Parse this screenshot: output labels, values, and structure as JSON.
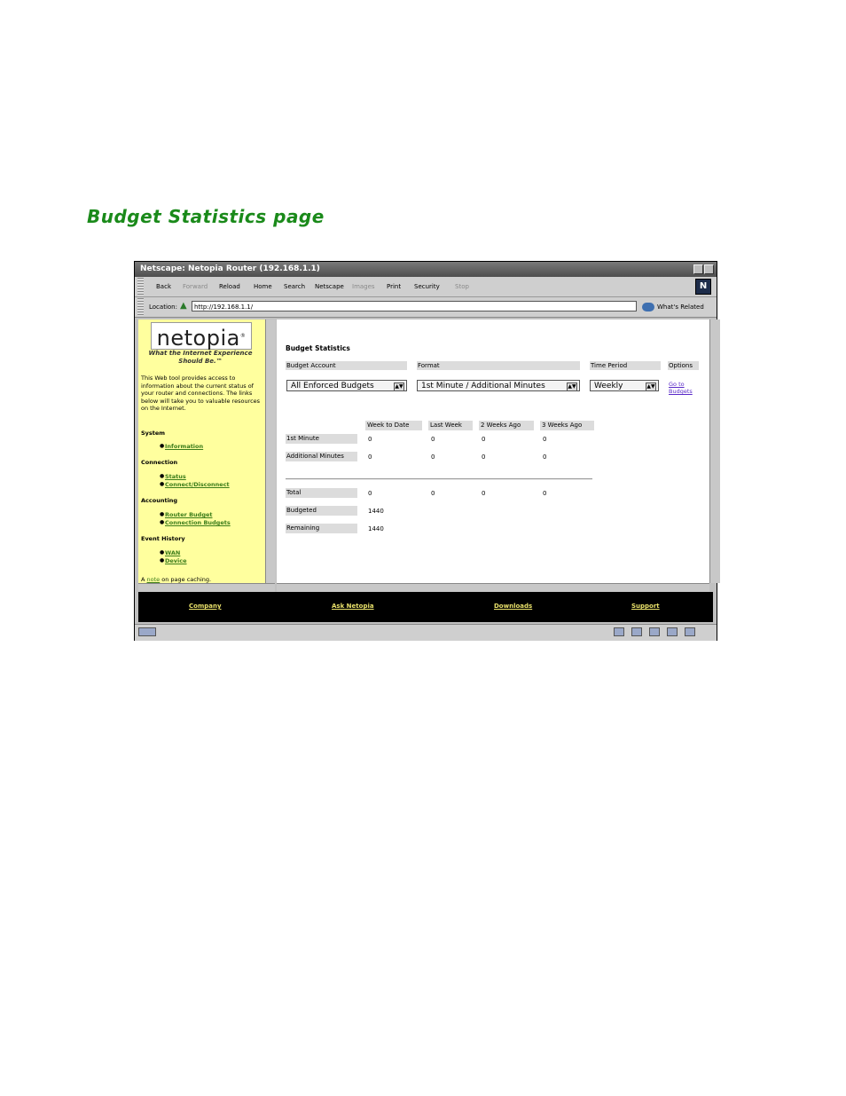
{
  "doc": {
    "heading": "Budget Statistics page"
  },
  "window": {
    "title": "Netscape: Netopia Router (192.168.1.1)"
  },
  "toolbar": {
    "items": [
      "Back",
      "Forward",
      "Reload",
      "Home",
      "Search",
      "Netscape",
      "Images",
      "Print",
      "Security",
      "Stop"
    ],
    "disabled": [
      "Forward",
      "Images",
      "Stop"
    ],
    "logo": "N"
  },
  "location": {
    "label": "Location:",
    "url": "http://192.168.1.1/",
    "related": "What's Related"
  },
  "sidebar": {
    "logo": "netopia",
    "logo_mark": "®",
    "tagline": "What the Internet Experience Should Be.™",
    "intro": "This Web tool provides access to information about the current status of your router and connections. The links below will take you to valuable resources on the Internet.",
    "sections": [
      {
        "title": "System",
        "links": [
          "Information"
        ]
      },
      {
        "title": "Connection",
        "links": [
          "Status",
          "Connect/Disconnect"
        ]
      },
      {
        "title": "Accounting",
        "links": [
          "Router Budget",
          "Connection Budgets"
        ]
      },
      {
        "title": "Event History",
        "links": [
          "WAN",
          "Device"
        ]
      }
    ],
    "note_prefix": "A",
    "note_link": "note",
    "note_suffix": "on page caching."
  },
  "main": {
    "heading": "Budget Statistics",
    "filters": {
      "account_label": "Budget Account",
      "format_label": "Format",
      "period_label": "Time Period",
      "options_label": "Options",
      "account_value": "All Enforced Budgets",
      "format_value": "1st Minute / Additional Minutes",
      "period_value": "Weekly",
      "goto_link": "Go to Budgets"
    },
    "columns": [
      "Week to Date",
      "Last Week",
      "2 Weeks Ago",
      "3 Weeks Ago"
    ],
    "rows": [
      {
        "label": "1st Minute",
        "values": [
          "0",
          "0",
          "0",
          "0"
        ]
      },
      {
        "label": "Additional Minutes",
        "values": [
          "0",
          "0",
          "0",
          "0"
        ]
      }
    ],
    "totals": [
      {
        "label": "Total",
        "values": [
          "0",
          "0",
          "0",
          "0"
        ]
      },
      {
        "label": "Budgeted",
        "values": [
          "1440"
        ]
      },
      {
        "label": "Remaining",
        "values": [
          "1440"
        ]
      }
    ]
  },
  "footer": {
    "links": [
      "Company",
      "Ask Netopia",
      "Downloads",
      "Support"
    ]
  },
  "colors": {
    "heading": "#1a8a1a",
    "sidebar_bg": "#ffff9e",
    "footer_bg": "#000000",
    "footer_link": "#e8e06a",
    "sidebar_link": "#3c7d1a"
  }
}
